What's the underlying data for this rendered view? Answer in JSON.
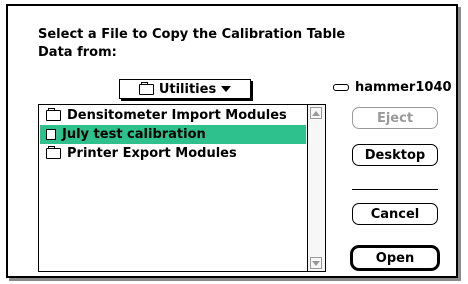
{
  "prompt": {
    "line1": "Select a File to Copy the Calibration Table",
    "line2": "Data from:"
  },
  "folder_popup": {
    "label": "Utilities"
  },
  "volume": {
    "name": "hammer1040"
  },
  "file_list": {
    "items": [
      {
        "name": "Densitometer Import Modules",
        "kind": "folder",
        "selected": false
      },
      {
        "name": "July test calibration",
        "kind": "document",
        "selected": true
      },
      {
        "name": "Printer Export Modules",
        "kind": "folder",
        "selected": false
      }
    ],
    "selection_color": "#2ec18d"
  },
  "buttons": {
    "eject": "Eject",
    "desktop": "Desktop",
    "cancel": "Cancel",
    "open": "Open"
  }
}
